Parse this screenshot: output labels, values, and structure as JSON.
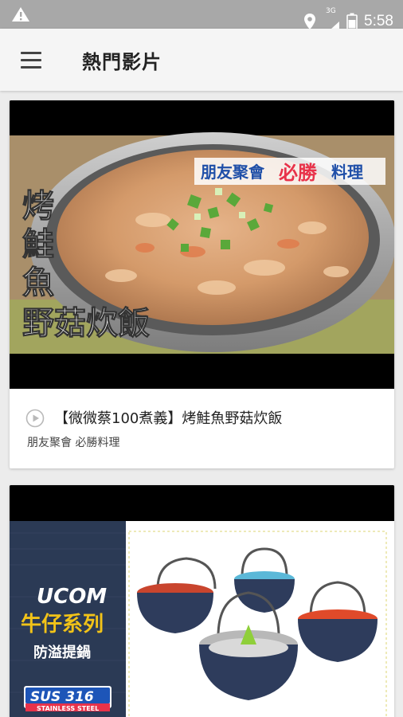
{
  "status_bar": {
    "network_label": "3G",
    "time": "5:58"
  },
  "app_bar": {
    "title": "熱門影片"
  },
  "videos": [
    {
      "title": "【微微蔡100煮義】烤鮭魚野菇炊飯",
      "subtitle": "朋友聚會 必勝料理",
      "thumbnail": {
        "tagline_part1": "朋友聚會",
        "tagline_part2": "必勝",
        "tagline_part3": "料理",
        "vertical_chars": [
          "烤",
          "鮭",
          "魚"
        ],
        "bottom_text": "野菇炊飯"
      }
    },
    {
      "thumbnail": {
        "brand": "UCOM",
        "series": "牛仔系列",
        "product": "防溢提鍋",
        "badge_main": "SUS 316",
        "badge_sub": "STAINLESS STEEL"
      }
    }
  ],
  "colors": {
    "status_bar": "#a8a8a8",
    "app_bar": "#f5f5f5",
    "background": "#ececec",
    "tagline_red": "#e8324a",
    "tagline_blue": "#1f4fa8",
    "series_yellow": "#f2c318",
    "denim": "#2b3a55"
  }
}
